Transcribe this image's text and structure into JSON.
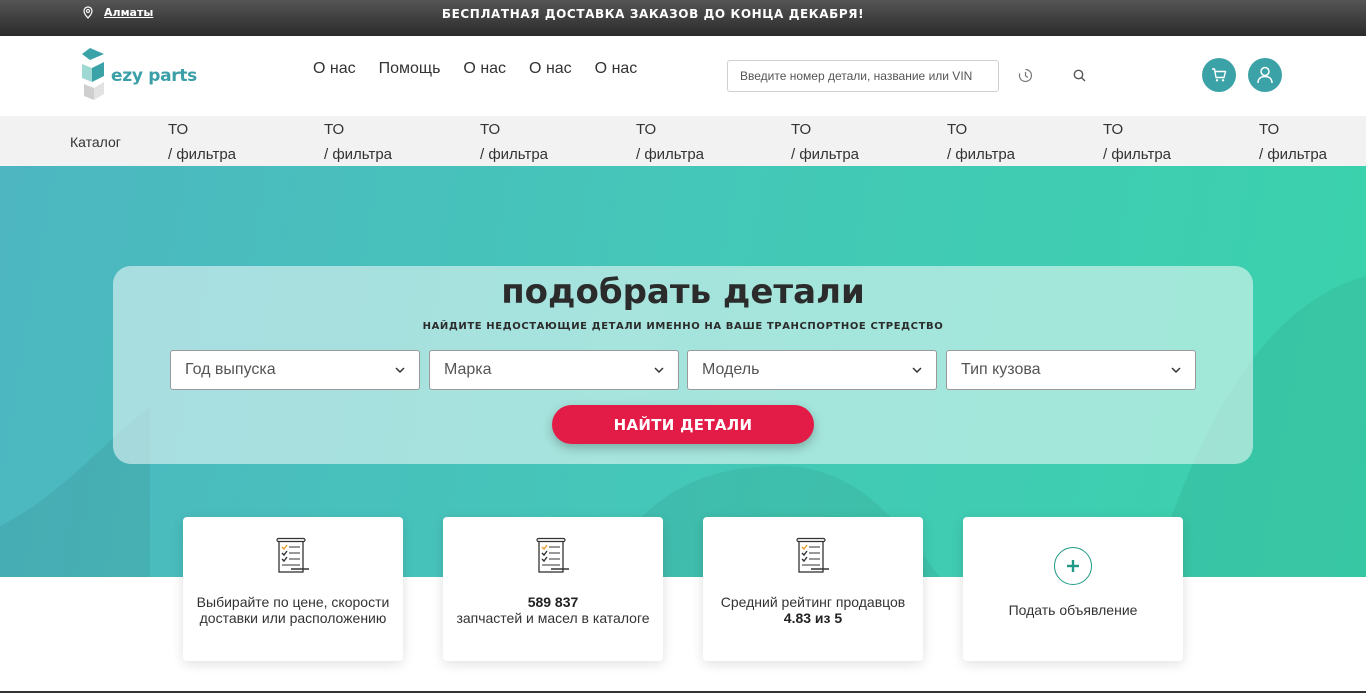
{
  "topbar": {
    "city": "Алматы",
    "promo": "БЕСПЛАТНАЯ ДОСТАВКА ЗАКАЗОВ ДО КОНЦА ДЕКАБРЯ!"
  },
  "header": {
    "logo_text": "ezy parts",
    "nav": [
      "О нас",
      "Помощь",
      "О нас",
      "О нас",
      "О нас"
    ],
    "search_placeholder": "Введите номер детали, название или VIN"
  },
  "catbar": {
    "catalog": "Каталог",
    "items": [
      {
        "line1": "ТО",
        "line2": "/ фильтра"
      },
      {
        "line1": "ТО",
        "line2": "/ фильтра"
      },
      {
        "line1": "ТО",
        "line2": "/ фильтра"
      },
      {
        "line1": "ТО",
        "line2": "/ фильтра"
      },
      {
        "line1": "ТО",
        "line2": "/ фильтра"
      },
      {
        "line1": "ТО",
        "line2": "/ фильтра"
      },
      {
        "line1": "ТО",
        "line2": "/ фильтра"
      },
      {
        "line1": "ТО",
        "line2": "/ фильтра"
      }
    ]
  },
  "hero": {
    "title": "подобрать детали",
    "subtitle": "НАЙДИТЕ НЕДОСТАЮЩИЕ ДЕТАЛИ ИМЕННО НА ВАШЕ ТРАНСПОРТНОЕ СТРЕДСТВО",
    "selects": [
      "Год выпуска",
      "Марка",
      "Модель",
      "Тип кузова"
    ],
    "button": "НАЙТИ ДЕТАЛИ"
  },
  "cards": [
    {
      "text": "Выбирайте по цене, скорости доставки или расположению"
    },
    {
      "bold": "589 837",
      "text": "запчастей и масел в каталоге"
    },
    {
      "text": "Средний рейтинг продавцов",
      "bold": "4.83 из 5"
    },
    {
      "text": "Подать объявление"
    }
  ],
  "colors": {
    "accent": "#3ba3a7",
    "cta": "#e31b47",
    "hero_start": "#4db6c1",
    "hero_end": "#3ad2ac"
  }
}
